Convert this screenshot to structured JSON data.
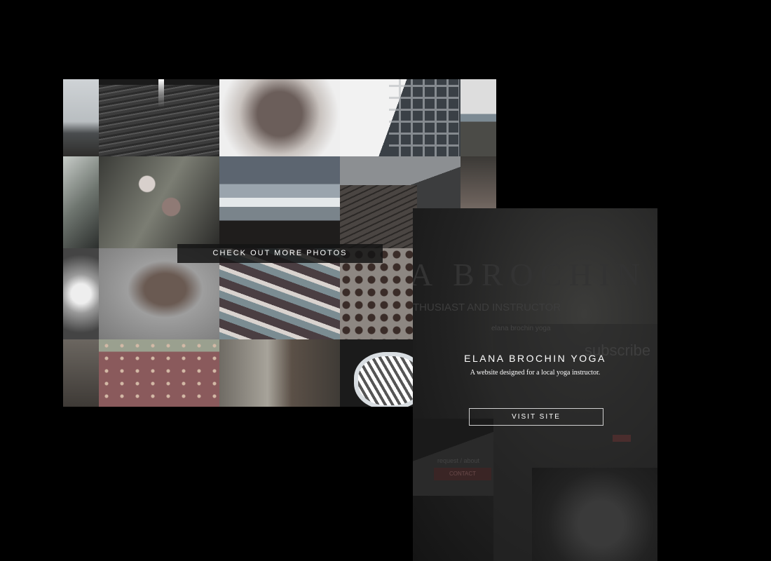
{
  "gallery": {
    "cta_label": "CHECK OUT MORE PHOTOS",
    "tiles": [
      "coast-sky",
      "dark-water",
      "food-closeup",
      "building-facade",
      "rocky-coast",
      "palm-leaf",
      "flower-garland",
      "ocean-waves",
      "wooden-dock",
      "market-produce",
      "glass-ornament",
      "spices",
      "fruit-market",
      "perforated-metal",
      "market-stand",
      "strawberry",
      "rooster",
      "sculpture"
    ]
  },
  "project": {
    "title": "ELANA BROCHIN YOGA",
    "description": "A website designed for a local yoga instructor.",
    "visit_label": "VISIT SITE"
  },
  "preview": {
    "brand_ghost": "A BROCHIN",
    "tagline_ghost": "THUSIAST AND INSTRUCTOR",
    "small_ghost": "elana brochin yoga",
    "subscribe_ghost": "subscribe",
    "footer_ghost": "request / about",
    "contact_ghost": "CONTACT"
  },
  "colors": {
    "background": "#000000",
    "card": "#1c1c1c",
    "text": "#ffffff"
  }
}
